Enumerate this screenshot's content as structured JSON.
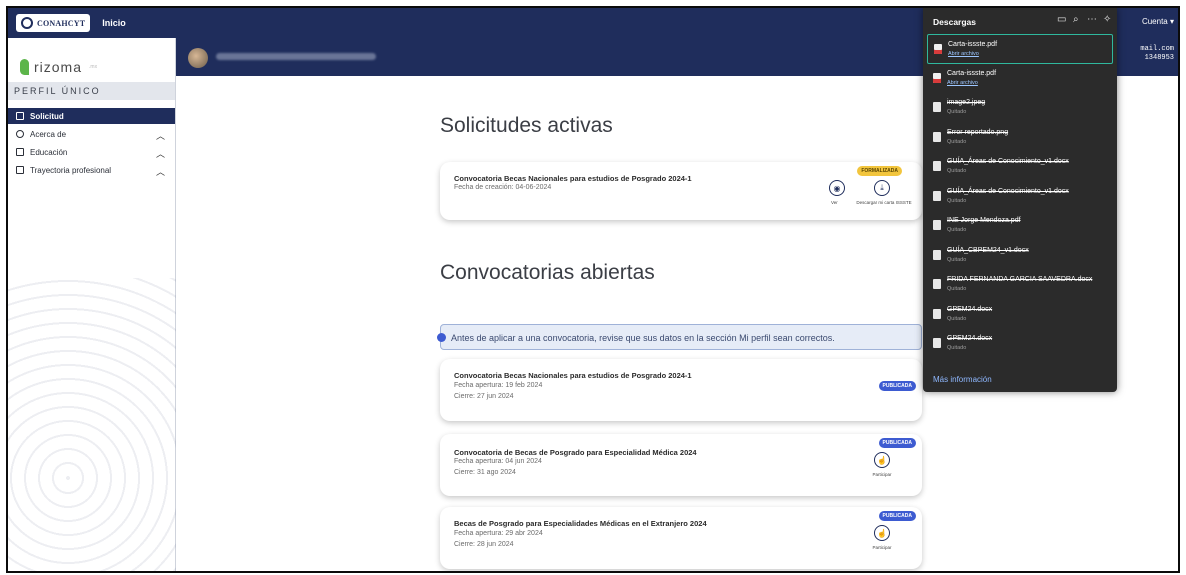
{
  "topbar": {
    "logo_text": "CONAHCYT",
    "home": "Inicio",
    "account": "Cuenta ▾"
  },
  "header": {
    "email_line1": "mail.com",
    "email_line2": "1348953"
  },
  "sidebar": {
    "brand": "rizoma",
    "brand_sub": ".mx",
    "section": "PERFIL ÚNICO",
    "items": [
      {
        "label": "Solicitud"
      },
      {
        "label": "Acerca de"
      },
      {
        "label": "Educación"
      },
      {
        "label": "Trayectoria profesional"
      }
    ]
  },
  "main": {
    "active_heading": "Solicitudes activas",
    "open_heading": "Convocatorias abiertas",
    "info_text": "Antes de aplicar a una convocatoria, revise que sus datos en la sección Mi perfil sean correctos.",
    "active_card": {
      "title": "Convocatoria Becas Nacionales para estudios de Posgrado 2024-1",
      "line1": "Fecha de creación: 04-06-2024",
      "badge": "FORMALIZADA",
      "view_label": "Ver",
      "download_label": "Descargar mi carta ISSSTE"
    },
    "open_cards": [
      {
        "title": "Convocatoria Becas Nacionales para estudios de Posgrado 2024-1",
        "line1": "Fecha apertura: 19 feb 2024",
        "line2": "Cierre: 27 jun 2024",
        "badge": "PUBLICADA"
      },
      {
        "title": "Convocatoria de Becas de Posgrado para Especialidad Médica 2024",
        "line1": "Fecha apertura: 04 jun 2024",
        "line2": "Cierre: 31 ago 2024",
        "badge": "PUBLICADA",
        "action": "Participar"
      },
      {
        "title": "Becas de Posgrado para Especialidades Médicas en el Extranjero 2024",
        "line1": "Fecha apertura: 29 abr 2024",
        "line2": "Cierre: 28 jun 2024",
        "badge": "PUBLICADA",
        "action": "Participar"
      }
    ]
  },
  "downloads": {
    "title": "Descargas",
    "more": "Más información",
    "items": [
      {
        "name": "Carta-issste.pdf",
        "status": "Abrir archivo"
      },
      {
        "name": "Carta-issste.pdf",
        "status": "Abrir archivo"
      },
      {
        "name": "image2.jpeg",
        "status": "Quitado"
      },
      {
        "name": "Error reportado.png",
        "status": "Quitado"
      },
      {
        "name": "GUÍA_Áreas de Conocimiento_v1.docx",
        "status": "Quitado"
      },
      {
        "name": "GUÍA_Áreas de Conocimiento_v1.docx",
        "status": "Quitado"
      },
      {
        "name": "INE Jorge Mendoza.pdf",
        "status": "Quitado"
      },
      {
        "name": "GUÍA_CBPEM24_v1.docx",
        "status": "Quitado"
      },
      {
        "name": "FRIDA FERNANDA GARCIA SAAVEDRA.docx",
        "status": "Quitado"
      },
      {
        "name": "GPEM24.docx",
        "status": "Quitado"
      },
      {
        "name": "GPEM24.docx",
        "status": "Quitado"
      }
    ]
  },
  "colors": {
    "navy": "#1f2d5c",
    "accent_green": "#5cb54a",
    "badge_blue": "#3d5bd1",
    "badge_yellow": "#f2c53d",
    "highlight": "#2fb89e"
  }
}
